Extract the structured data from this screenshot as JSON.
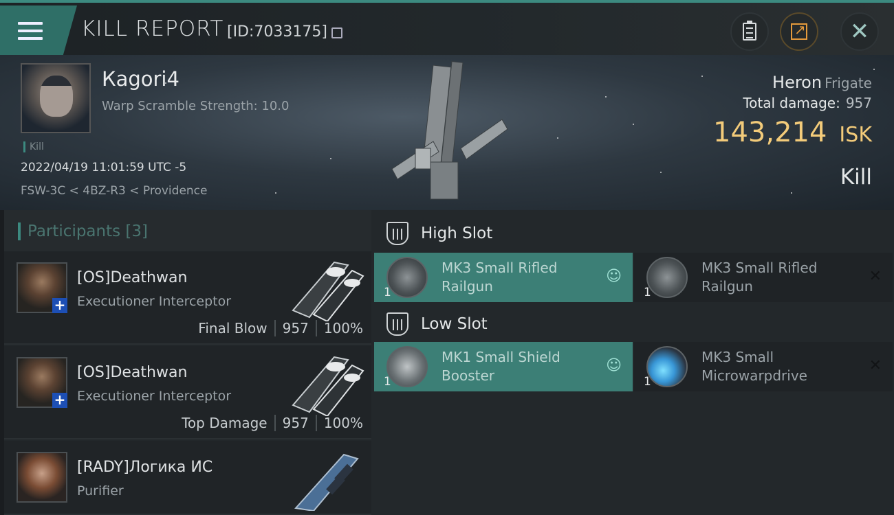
{
  "header": {
    "title": "KILL REPORT",
    "id_label": "[ID:7033175]",
    "buttons": {
      "clipboard": "clipboard-icon",
      "share": "share-icon",
      "close": "close-icon"
    }
  },
  "victim": {
    "pilot": "Кagori4",
    "warp_scramble": "Warp Scramble Strength: 10.0",
    "tag": "Kill",
    "datetime": "2022/04/19 11:01:59 UTC -5",
    "location": "FSW-3C < 4BZ-R3 < Providence",
    "ship_name": "Heron",
    "ship_class": "Frigate",
    "total_damage_label": "Total damage:",
    "total_damage": "957",
    "isk_value": "143,214",
    "isk_unit": "ISK",
    "outcome": "Kill"
  },
  "participants": {
    "label": "Participants",
    "count": "[3]",
    "rows": [
      {
        "name": "[OS]Deathwan",
        "ship": "Executioner Interceptor",
        "tag": "Final Blow",
        "damage": "957",
        "percent": "100%",
        "badge": "+"
      },
      {
        "name": "[OS]Deathwan",
        "ship": "Executioner Interceptor",
        "tag": "Top Damage",
        "damage": "957",
        "percent": "100%",
        "badge": "+"
      },
      {
        "name": "[RADY]Логика ИС",
        "ship": "Purifier"
      }
    ]
  },
  "fittings": {
    "high_slot": {
      "label": "High Slot",
      "modules": [
        {
          "name": "MK3 Small Rifled Railgun",
          "qty": "1",
          "status": "fitted"
        },
        {
          "name": "MK3 Small Rifled Railgun",
          "qty": "1",
          "status": "dropped"
        }
      ]
    },
    "low_slot": {
      "label": "Low Slot",
      "modules": [
        {
          "name": "MK1 Small Shield Booster",
          "qty": "1",
          "status": "fitted"
        },
        {
          "name": "MK3 Small Microwarpdrive",
          "qty": "1",
          "status": "dropped"
        }
      ]
    }
  },
  "colors": {
    "accent": "#3c8a80",
    "isk": "#f3cb7a",
    "fitted_bg": "#3c7f76",
    "badge": "#1d4fb5"
  }
}
